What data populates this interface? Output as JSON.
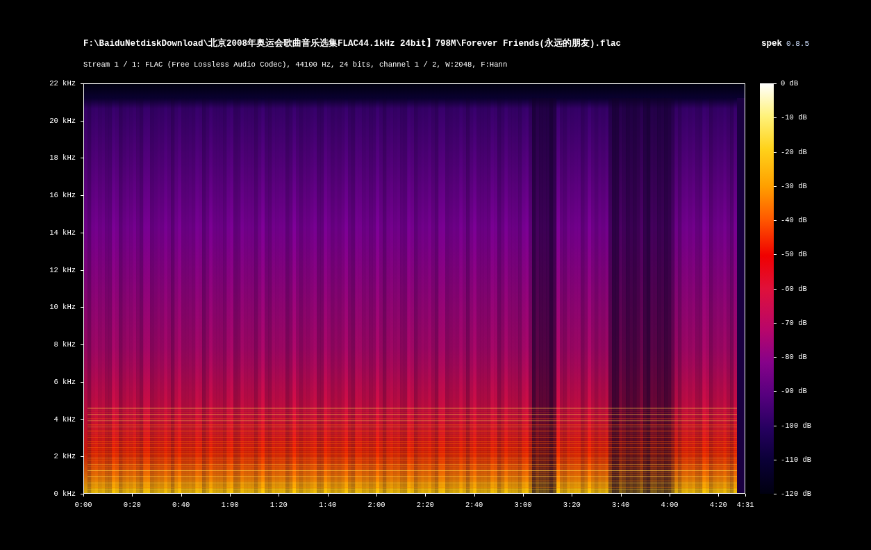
{
  "file_title": "F:\\BaiduNetdiskDownload\\北京2008年奥运会歌曲音乐选集FLAC44.1kHz 24bit】798M\\Forever Friends(永远的朋友).flac",
  "app": {
    "name": "spek",
    "version": "0.8.5"
  },
  "stream_info": "Stream 1 / 1: FLAC (Free Lossless Audio Codec), 44100 Hz, 24 bits, channel 1 / 2, W:2048, F:Hann",
  "frequency_axis": [
    "22 kHz",
    "20 kHz",
    "18 kHz",
    "16 kHz",
    "14 kHz",
    "12 kHz",
    "10 kHz",
    "8 kHz",
    "6 kHz",
    "4 kHz",
    "2 kHz",
    "0 kHz"
  ],
  "time_axis": [
    "0:00",
    "0:20",
    "0:40",
    "1:00",
    "1:20",
    "1:40",
    "2:00",
    "2:20",
    "2:40",
    "3:00",
    "3:20",
    "3:40",
    "4:00",
    "4:20",
    "4:31"
  ],
  "color_scale": [
    "0 dB",
    "-10 dB",
    "-20 dB",
    "-30 dB",
    "-40 dB",
    "-50 dB",
    "-60 dB",
    "-70 dB",
    "-80 dB",
    "-90 dB",
    "-100 dB",
    "-110 dB",
    "-120 dB"
  ]
}
